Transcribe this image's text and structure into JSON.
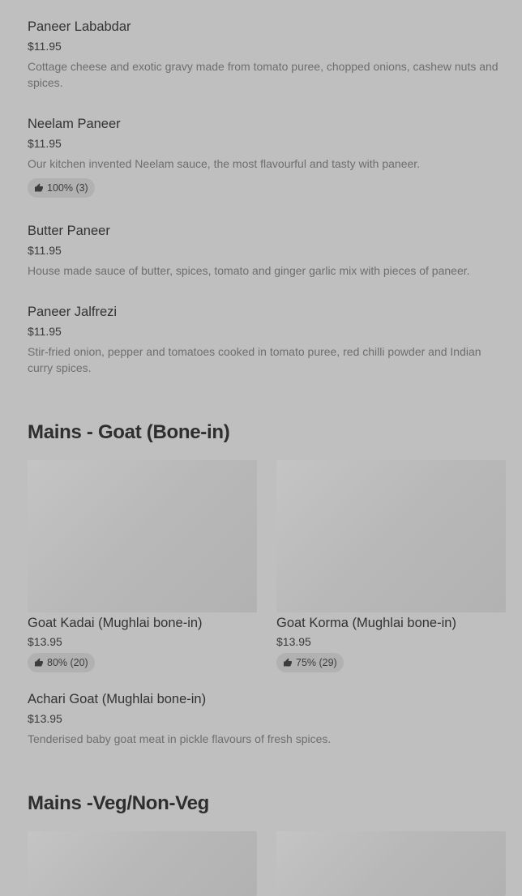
{
  "veg_items": [
    {
      "name": "Paneer Lababdar",
      "price": "$11.95",
      "description": "Cottage cheese and exotic gravy made from tomato puree, chopped onions, cashew nuts and spices."
    },
    {
      "name": "Neelam Paneer",
      "price": "$11.95",
      "description": "Our kitchen invented Neelam sauce, the most flavourful and tasty with paneer.",
      "rating": "100% (3)"
    },
    {
      "name": "Butter Paneer",
      "price": "$11.95",
      "description": "House made sauce of butter, spices, tomato and ginger garlic mix with pieces of paneer."
    },
    {
      "name": "Paneer Jalfrezi",
      "price": "$11.95",
      "description": "Stir-fried onion, pepper and tomatoes cooked in tomato puree, red chilli powder and Indian curry spices."
    }
  ],
  "goat_section": {
    "title": "Mains - Goat (Bone-in)",
    "cards": [
      {
        "name": "Goat Kadai (Mughlai bone-in)",
        "price": "$13.95",
        "rating": "80% (20)"
      },
      {
        "name": "Goat Korma (Mughlai bone-in)",
        "price": "$13.95",
        "rating": "75% (29)"
      }
    ],
    "items": [
      {
        "name": "Achari Goat (Mughlai bone-in)",
        "price": "$13.95",
        "description": "Tenderised baby goat meat in pickle flavours of fresh spices."
      }
    ]
  },
  "vegnonveg_section": {
    "title": "Mains -Veg/Non-Veg"
  },
  "icons": {
    "rating": "thumbs-up-icon"
  }
}
